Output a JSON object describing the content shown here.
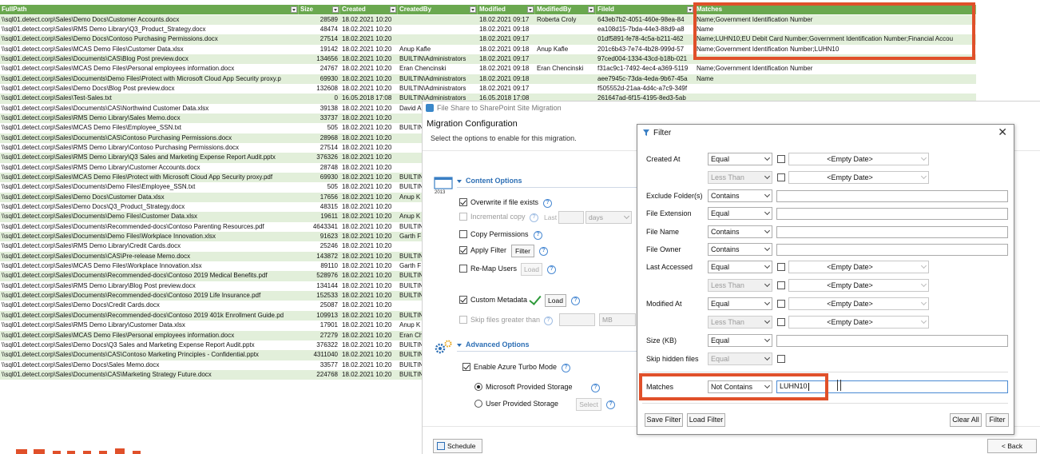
{
  "sheet": {
    "headers": [
      "FullPath",
      "Size",
      "Created",
      "CreatedBy",
      "Modified",
      "ModifiedBy",
      "FileId",
      "Matches"
    ],
    "rows": [
      [
        "\\\\sql01.detect.corp\\Sales\\Demo Docs\\Customer Accounts.docx",
        "28589",
        "18.02.2021 10:20",
        "",
        "18.02.2021 09:17",
        "Roberta Croly",
        "643eb7b2-4051-460e-98ea-84",
        "Name;Government Identification Number"
      ],
      [
        "\\\\sql01.detect.corp\\Sales\\RMS Demo Library\\Q3_Product_Strategy.docx",
        "48474",
        "18.02.2021 10:20",
        "",
        "18.02.2021 09:18",
        "",
        "ea108d15-7bda-44e3-88d9-a8",
        "Name"
      ],
      [
        "\\\\sql01.detect.corp\\Sales\\Demo Docs\\Contoso Purchasing Permissions.docx",
        "27514",
        "18.02.2021 10:20",
        "",
        "18.02.2021 09:17",
        "",
        "01df5891-fe78-4c5a-b211-462",
        "Name;LUHN10;EU Debit Card Number;Government Identification Number;Financial Accou"
      ],
      [
        "\\\\sql01.detect.corp\\Sales\\MCAS Demo Files\\Customer Data.xlsx",
        "19142",
        "18.02.2021 10:20",
        "Anup Kafle",
        "18.02.2021 09:18",
        "Anup Kafle",
        "201c6b43-7e74-4b28-999d-57",
        "Name;Government Identification Number;LUHN10"
      ],
      [
        "\\\\sql01.detect.corp\\Sales\\Documents\\CAS\\Blog Post preview.docx",
        "134656",
        "18.02.2021 10:20",
        "BUILTIN\\Administrators",
        "18.02.2021 09:17",
        "",
        "97ced004-1334-43cd-b18b-021",
        ""
      ],
      [
        "\\\\sql01.detect.corp\\Sales\\MCAS Demo Files\\Personal employees information.docx",
        "24767",
        "18.02.2021 10:20",
        "Eran Chencinski",
        "18.02.2021 09:18",
        "Eran Chencinski",
        "f31ac9c1-7492-4ec4-a369-5119",
        "Name;Government Identification Number"
      ],
      [
        "\\\\sql01.detect.corp\\Sales\\Documents\\Demo Files\\Protect with Microsoft Cloud App Security proxy.p",
        "69930",
        "18.02.2021 10:20",
        "BUILTIN\\Administrators",
        "18.02.2021 09:18",
        "",
        "aee7945c-73da-4eda-9b67-45a",
        "Name"
      ],
      [
        "\\\\sql01.detect.corp\\Sales\\Demo Docs\\Blog Post preview.docx",
        "132608",
        "18.02.2021 10:20",
        "BUILTIN\\Administrators",
        "18.02.2021 09:17",
        "",
        "f505552d-21aa-4d4c-a7c9-349f",
        ""
      ],
      [
        "\\\\sql01.detect.corp\\Sales\\Test-Sales.txt",
        "0",
        "16.05.2018 17:08",
        "BUILTIN\\Administrators",
        "16.05.2018 17:08",
        "",
        "261647ad-6f15-4195-8ed3-5ab",
        ""
      ],
      [
        "\\\\sql01.detect.corp\\Sales\\Documents\\CAS\\Northwind Customer Data.xlsx",
        "39138",
        "18.02.2021 10:20",
        "David A",
        "",
        "",
        "",
        ""
      ],
      [
        "\\\\sql01.detect.corp\\Sales\\RMS Demo Library\\Sales Memo.docx",
        "33737",
        "18.02.2021 10:20",
        "",
        "",
        "",
        "",
        ""
      ],
      [
        "\\\\sql01.detect.corp\\Sales\\MCAS Demo Files\\Employee_SSN.txt",
        "505",
        "18.02.2021 10:20",
        "BUILTIN",
        "",
        "",
        "",
        ""
      ],
      [
        "\\\\sql01.detect.corp\\Sales\\Documents\\CAS\\Contoso Purchasing Permissions.docx",
        "28968",
        "18.02.2021 10:20",
        "",
        "",
        "",
        "",
        ""
      ],
      [
        "\\\\sql01.detect.corp\\Sales\\RMS Demo Library\\Contoso Purchasing Permissions.docx",
        "27514",
        "18.02.2021 10:20",
        "",
        "",
        "",
        "",
        ""
      ],
      [
        "\\\\sql01.detect.corp\\Sales\\RMS Demo Library\\Q3 Sales and Marketing Expense Report Audit.pptx",
        "376326",
        "18.02.2021 10:20",
        "",
        "",
        "",
        "",
        ""
      ],
      [
        "\\\\sql01.detect.corp\\Sales\\RMS Demo Library\\Customer Accounts.docx",
        "28748",
        "18.02.2021 10:20",
        "",
        "",
        "",
        "",
        ""
      ],
      [
        "\\\\sql01.detect.corp\\Sales\\MCAS Demo Files\\Protect with Microsoft Cloud App Security proxy.pdf",
        "69930",
        "18.02.2021 10:20",
        "BUILTIN",
        "",
        "",
        "",
        ""
      ],
      [
        "\\\\sql01.detect.corp\\Sales\\Documents\\Demo Files\\Employee_SSN.txt",
        "505",
        "18.02.2021 10:20",
        "BUILTIN",
        "",
        "",
        "",
        ""
      ],
      [
        "\\\\sql01.detect.corp\\Sales\\Demo Docs\\Customer Data.xlsx",
        "17656",
        "18.02.2021 10:20",
        "Anup K",
        "",
        "",
        "",
        ""
      ],
      [
        "\\\\sql01.detect.corp\\Sales\\Demo Docs\\Q3_Product_Strategy.docx",
        "48315",
        "18.02.2021 10:20",
        "",
        "",
        "",
        "",
        ""
      ],
      [
        "\\\\sql01.detect.corp\\Sales\\Documents\\Demo Files\\Customer Data.xlsx",
        "19611",
        "18.02.2021 10:20",
        "Anup K",
        "",
        "",
        "",
        ""
      ],
      [
        "\\\\sql01.detect.corp\\Sales\\Documents\\Recommended-docs\\Contoso Parenting Resources.pdf",
        "4643341",
        "18.02.2021 10:20",
        "BUILTIN",
        "",
        "",
        "",
        ""
      ],
      [
        "\\\\sql01.detect.corp\\Sales\\Documents\\Demo Files\\Workplace Innovation.xlsx",
        "91623",
        "18.02.2021 10:20",
        "Garth F",
        "",
        "",
        "",
        ""
      ],
      [
        "\\\\sql01.detect.corp\\Sales\\RMS Demo Library\\Credit Cards.docx",
        "25246",
        "18.02.2021 10:20",
        "",
        "",
        "",
        "",
        ""
      ],
      [
        "\\\\sql01.detect.corp\\Sales\\Documents\\CAS\\Pre-release Memo.docx",
        "143872",
        "18.02.2021 10:20",
        "BUILTIN",
        "",
        "",
        "",
        ""
      ],
      [
        "\\\\sql01.detect.corp\\Sales\\MCAS Demo Files\\Workplace Innovation.xlsx",
        "89110",
        "18.02.2021 10:20",
        "Garth F",
        "",
        "",
        "",
        ""
      ],
      [
        "\\\\sql01.detect.corp\\Sales\\Documents\\Recommended-docs\\Contoso 2019 Medical Benefits.pdf",
        "528976",
        "18.02.2021 10:20",
        "BUILTIN",
        "",
        "",
        "",
        ""
      ],
      [
        "\\\\sql01.detect.corp\\Sales\\RMS Demo Library\\Blog Post preview.docx",
        "134144",
        "18.02.2021 10:20",
        "BUILTIN",
        "",
        "",
        "",
        ""
      ],
      [
        "\\\\sql01.detect.corp\\Sales\\Documents\\Recommended-docs\\Contoso 2019 Life Insurance.pdf",
        "152533",
        "18.02.2021 10:20",
        "BUILTIN",
        "",
        "",
        "",
        ""
      ],
      [
        "\\\\sql01.detect.corp\\Sales\\Demo Docs\\Credit Cards.docx",
        "25087",
        "18.02.2021 10:20",
        "",
        "",
        "",
        "",
        ""
      ],
      [
        "\\\\sql01.detect.corp\\Sales\\Documents\\Recommended-docs\\Contoso 2019 401k Enrollment Guide.pd",
        "109913",
        "18.02.2021 10:20",
        "BUILTIN",
        "",
        "",
        "",
        ""
      ],
      [
        "\\\\sql01.detect.corp\\Sales\\RMS Demo Library\\Customer Data.xlsx",
        "17901",
        "18.02.2021 10:20",
        "Anup K",
        "",
        "",
        "",
        ""
      ],
      [
        "\\\\sql01.detect.corp\\Sales\\MCAS Demo Files\\Personal employees information.docx",
        "27279",
        "18.02.2021 10:20",
        "Eran Ch",
        "",
        "",
        "",
        ""
      ],
      [
        "\\\\sql01.detect.corp\\Sales\\Demo Docs\\Q3 Sales and Marketing Expense Report Audit.pptx",
        "376322",
        "18.02.2021 10:20",
        "BUILTIN",
        "",
        "",
        "",
        ""
      ],
      [
        "\\\\sql01.detect.corp\\Sales\\Documents\\CAS\\Contoso Marketing Principles - Confidential.pptx",
        "4311040",
        "18.02.2021 10:20",
        "BUILTIN",
        "",
        "",
        "",
        ""
      ],
      [
        "\\\\sql01.detect.corp\\Sales\\Demo Docs\\Sales Memo.docx",
        "33577",
        "18.02.2021 10:20",
        "BUILTIN",
        "",
        "",
        "",
        ""
      ],
      [
        "\\\\sql01.detect.corp\\Sales\\Documents\\CAS\\Marketing Strategy Future.docx",
        "224768",
        "18.02.2021 10:20",
        "BUILTIN",
        "",
        "",
        "",
        ""
      ]
    ]
  },
  "migration": {
    "window_title": "File Share to SharePoint Site Migration",
    "heading": "Migration Configuration",
    "subheading": "Select the options to enable for this migration.",
    "content_options": {
      "title": "Content Options",
      "icon_caption": "2013",
      "overwrite_label": "Overwrite if file exists",
      "incremental_label": "Incremental copy",
      "last_label": "Last",
      "days_value": "days",
      "copy_permissions_label": "Copy Permissions",
      "apply_filter_label": "Apply Filter",
      "filter_button": "Filter",
      "remap_users_label": "Re-Map Users",
      "load_button": "Load",
      "custom_metadata_label": "Custom Metadata",
      "load_button_2": "Load",
      "skip_files_label": "Skip files greater than",
      "mb_value": "MB"
    },
    "advanced_options": {
      "title": "Advanced Options",
      "turbo_label": "Enable Azure Turbo Mode",
      "microsoft_storage_label": "Microsoft Provided Storage",
      "user_storage_label": "User Provided Storage",
      "select_button": "Select"
    },
    "schedule_button": "Schedule",
    "back_button": "< Back"
  },
  "filter": {
    "title": "Filter",
    "close_glyph": "✕",
    "empty_date": "<Empty Date>",
    "labels": {
      "created_at": "Created At",
      "exclude_folders": "Exclude Folder(s)",
      "file_extension": "File Extension",
      "file_name": "File Name",
      "file_owner": "File Owner",
      "last_accessed": "Last Accessed",
      "modified_at": "Modified At",
      "size_kb": "Size (KB)",
      "skip_hidden": "Skip hidden files",
      "matches": "Matches"
    },
    "ops": {
      "created_at": "Equal",
      "created_at_2": "Less Than",
      "exclude_folders": "Contains",
      "file_extension": "Equal",
      "file_name": "Contains",
      "file_owner": "Contains",
      "last_accessed": "Equal",
      "last_accessed_2": "Less Than",
      "modified_at": "Equal",
      "modified_at_2": "Less Than",
      "size_kb": "Equal",
      "skip_hidden": "Equal",
      "matches": "Not Contains"
    },
    "matches_value": "LUHN10",
    "buttons": {
      "save": "Save Filter",
      "load": "Load Filter",
      "clear": "Clear All",
      "filter": "Filter"
    }
  },
  "colors": {
    "header_green": "#6aa84f",
    "row_band": "#e2efda",
    "highlight_orange": "#e0502a",
    "accent_blue": "#2d6fb5"
  }
}
